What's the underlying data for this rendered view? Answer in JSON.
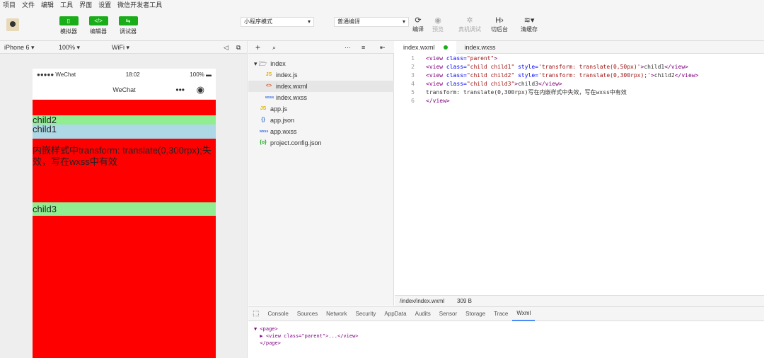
{
  "menu": [
    "项目",
    "文件",
    "编辑",
    "工具",
    "界面",
    "设置",
    "微信开发者工具"
  ],
  "toolbar": {
    "simulator": "模拟器",
    "editor": "编辑器",
    "debugger": "调试器",
    "mode": "小程序模式",
    "compile_mode": "普通编译",
    "compile": "编译",
    "preview": "预览",
    "remote_debug": "真机调试",
    "background": "切后台",
    "clear_cache": "清缓存"
  },
  "sim": {
    "device": "iPhone 6",
    "zoom": "100%",
    "network": "WiFi"
  },
  "phone": {
    "carrier": "●●●●● WeChat",
    "time": "18:02",
    "battery": "100%",
    "title": "WeChat",
    "child2": "child2",
    "child1": "child1",
    "text": "内嵌样式中transform: translate(0,300rpx);失效，写在wxss中有效",
    "child3": "child3"
  },
  "tree": {
    "folder": "index",
    "files": [
      "index.js",
      "index.wxml",
      "index.wxss"
    ],
    "root_files": [
      "app.js",
      "app.json",
      "app.wxss",
      "project.config.json"
    ],
    "icons": [
      "JS",
      "<>",
      "wxss",
      "JS",
      "{}",
      "wxss",
      "{o}"
    ]
  },
  "tabs": [
    "index.wxml",
    "index.wxss"
  ],
  "code": [
    {
      "n": "1",
      "html": "<span class='tag'>&lt;view</span> <span class='at'>class=</span><span class='st'>\"parent\"</span><span class='tag'>&gt;</span>"
    },
    {
      "n": "2",
      "html": "<span class='tag'>&lt;view</span> <span class='at'>class=</span><span class='st'>\"child child1\"</span> <span class='at'>style=</span><span class='st'>'transform: translate(0,50px)'</span><span class='tag'>&gt;</span>child1<span class='tag'>&lt;/view&gt;</span>"
    },
    {
      "n": "3",
      "html": "<span class='tag'>&lt;view</span> <span class='at'>class=</span><span class='st'>\"child child2\"</span> <span class='at'>style=</span><span class='st'>'transform: translate(0,300rpx);'</span><span class='tag'>&gt;</span>child2<span class='tag'>&lt;/view&gt;</span>"
    },
    {
      "n": "4",
      "html": "<span class='tag'>&lt;view</span> <span class='at'>class=</span><span class='st'>\"child child3\"</span><span class='tag'>&gt;</span>child3<span class='tag'>&lt;/view&gt;</span>"
    },
    {
      "n": "5",
      "html": "transform: translate(0,300rpx)写在内嵌样式中失效，写在wxss中有效"
    },
    {
      "n": "6",
      "html": "<span class='tag'>&lt;/view&gt;</span>"
    }
  ],
  "editor_status": {
    "path": "/index/index.wxml",
    "size": "309 B"
  },
  "devtools": [
    "Console",
    "Sources",
    "Network",
    "Security",
    "AppData",
    "Audits",
    "Sensor",
    "Storage",
    "Trace",
    "Wxml"
  ],
  "wxml": {
    "l1": "▼ <page>",
    "l2": "  ▶ <view class=\"parent\">...</view>",
    "l3": "  </page>"
  }
}
